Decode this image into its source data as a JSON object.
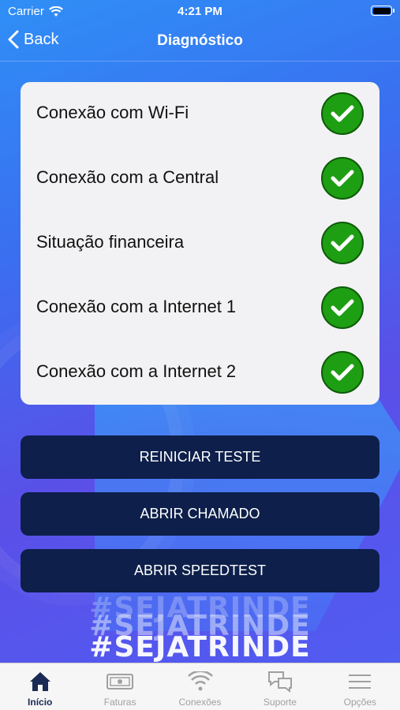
{
  "status_bar": {
    "carrier": "Carrier",
    "time": "4:21 PM"
  },
  "nav": {
    "back_label": "Back",
    "title": "Diagnóstico"
  },
  "checks": [
    {
      "label": "Conexão com Wi-Fi",
      "status": "ok"
    },
    {
      "label": "Conexão com a Central",
      "status": "ok"
    },
    {
      "label": "Situação financeira",
      "status": "ok"
    },
    {
      "label": "Conexão com a Internet 1",
      "status": "ok"
    },
    {
      "label": "Conexão com a Internet 2",
      "status": "ok"
    }
  ],
  "buttons": {
    "restart": "REINICIAR TESTE",
    "ticket": "ABRIR CHAMADO",
    "speedtest": "ABRIR SPEEDTEST"
  },
  "watermark": "#SEJATRINDE",
  "tabs": [
    {
      "label": "Início",
      "icon": "home-icon",
      "active": true
    },
    {
      "label": "Faturas",
      "icon": "invoice-icon",
      "active": false
    },
    {
      "label": "Conexões",
      "icon": "wifi-icon",
      "active": false
    },
    {
      "label": "Suporte",
      "icon": "chat-icon",
      "active": false
    },
    {
      "label": "Opções",
      "icon": "menu-icon",
      "active": false
    }
  ],
  "colors": {
    "check_green": "#1e9e12",
    "button_navy": "#0d1f4a",
    "active_tab": "#1a2a55"
  }
}
